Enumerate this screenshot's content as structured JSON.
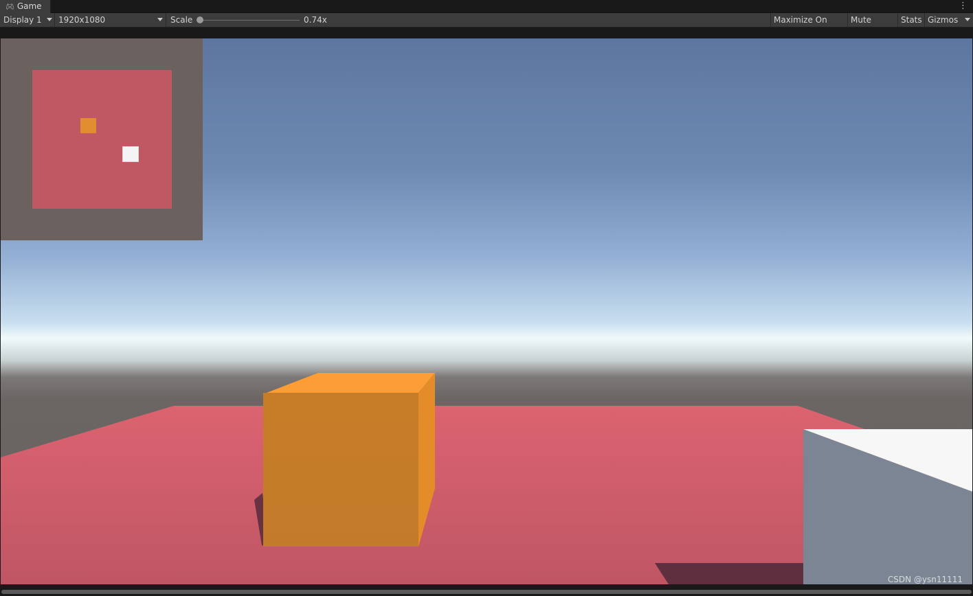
{
  "window": {
    "tab_title": "Game",
    "menu": "⋮"
  },
  "toolbar": {
    "display": "Display 1",
    "resolution": "1920x1080",
    "scale_label": "Scale",
    "scale_value": "0.74x",
    "scale_fraction": 0.0,
    "maximize_on_play": "Maximize On Play",
    "mute_audio": "Mute Audio",
    "stats": "Stats",
    "gizmos": "Gizmos"
  },
  "scene": {
    "sky_top": "#5d76a0",
    "horizon": "#f0fafa",
    "ground_color": "#676260",
    "plane_color": "#d35e6b",
    "cube_color": "#c77d28",
    "player_color": "#7b8593"
  },
  "minimap": {
    "background": "#6b625f",
    "plane": "#c05864",
    "cube": "#e28d2f",
    "player": "#f4f4f4"
  },
  "watermark": "CSDN @ysn11111"
}
